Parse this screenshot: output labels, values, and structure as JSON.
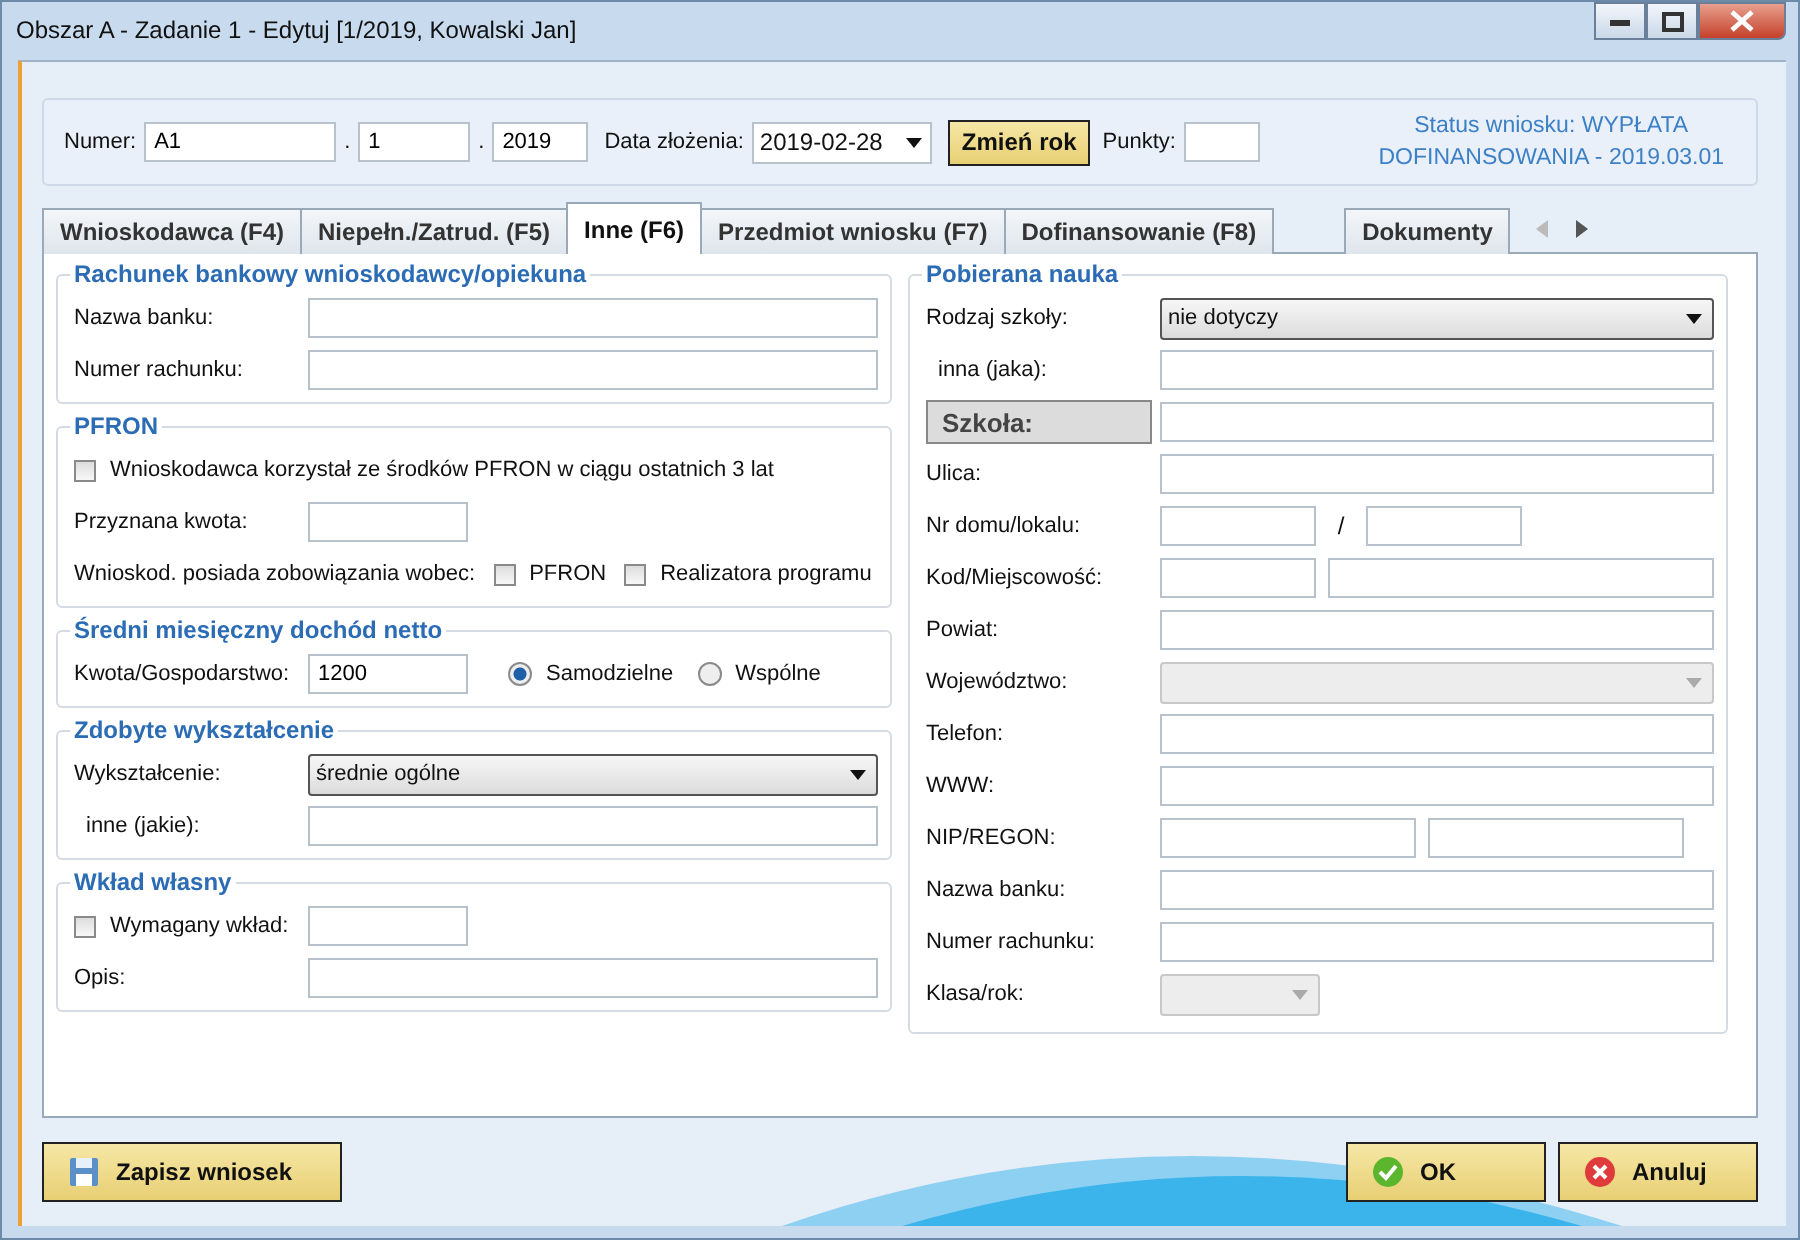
{
  "window": {
    "title": "Obszar A - Zadanie 1 - Edytuj  [1/2019, Kowalski Jan]"
  },
  "header": {
    "numer_label": "Numer:",
    "numer_parts": [
      {
        "value": "A1"
      },
      {
        "separator": ".",
        "value": "1"
      },
      {
        "separator": ".",
        "value": "2019"
      }
    ],
    "date_label": "Data złożenia:",
    "date_value": "2019-02-28",
    "change_year_button": "Zmień rok",
    "points_label": "Punkty:",
    "status_lines": [
      "Status wniosku: WYPŁATA",
      "DOFINANSOWANIA - 2019.03.01"
    ]
  },
  "tabs": [
    {
      "label": "Wnioskodawca (F4)",
      "selected": false
    },
    {
      "label": "Niepełn./Zatrud. (F5)",
      "selected": false
    },
    {
      "label": "Inne (F6)",
      "selected": true
    },
    {
      "label": "Przedmiot wniosku (F7)",
      "selected": false
    },
    {
      "label": "Dofinansowanie (F8)",
      "selected": false
    },
    {
      "label": "Dokumenty",
      "selected": false
    }
  ],
  "left_groups": [
    {
      "title": "Rachunek bankowy wnioskodawcy/opiekuna",
      "rows": [
        {
          "kind": "field",
          "label": "Nazwa banku:"
        },
        {
          "kind": "field",
          "label": "Numer rachunku:"
        }
      ]
    },
    {
      "title": "PFRON",
      "rows": [
        {
          "kind": "checkbox",
          "label": "Wnioskodawca korzystał ze środków PFRON w ciągu ostatnich 3 lat",
          "checked": false
        },
        {
          "kind": "field_short",
          "label": "Przyznana kwota:"
        },
        {
          "kind": "checks",
          "label": "Wnioskod. posiada zobowiązania wobec:",
          "options": [
            {
              "label": "PFRON",
              "checked": false
            },
            {
              "label": "Realizatora programu",
              "checked": false
            }
          ]
        }
      ]
    },
    {
      "title": "Średni miesięczny dochód netto",
      "rows": [
        {
          "kind": "radios",
          "label": "Kwota/Gospodarstwo:",
          "value": "1200",
          "options": [
            {
              "label": "Samodzielne",
              "selected": true
            },
            {
              "label": "Wspólne",
              "selected": false
            }
          ]
        }
      ]
    },
    {
      "title": "Zdobyte wykształcenie",
      "rows": [
        {
          "kind": "select",
          "label": "Wykształcenie:",
          "value": "średnie ogólne",
          "disabled": false
        },
        {
          "kind": "field",
          "label": "inne (jakie):",
          "indent": true
        }
      ]
    },
    {
      "title": "Wkład własny",
      "rows": [
        {
          "kind": "check_field",
          "label": "Wymagany wkład:",
          "checked": false
        },
        {
          "kind": "field",
          "label": "Opis:"
        }
      ]
    }
  ],
  "right_group": {
    "title": "Pobierana nauka",
    "rows": [
      {
        "kind": "select",
        "label": "Rodzaj szkoły:",
        "value": "nie dotyczy",
        "disabled": false
      },
      {
        "kind": "field",
        "label": "inna (jaka):",
        "indent": true
      },
      {
        "kind": "boxed",
        "label": "Szkoła:"
      },
      {
        "kind": "field",
        "label": "Ulica:"
      },
      {
        "kind": "pair_sep",
        "label": "Nr domu/lokalu:",
        "separator": "/"
      },
      {
        "kind": "pair_postal",
        "label": "Kod/Miejscowość:"
      },
      {
        "kind": "field",
        "label": "Powiat:"
      },
      {
        "kind": "select",
        "label": "Województwo:",
        "disabled": true
      },
      {
        "kind": "field",
        "label": "Telefon:"
      },
      {
        "kind": "field",
        "label": "WWW:"
      },
      {
        "kind": "pair_even",
        "label": "NIP/REGON:"
      },
      {
        "kind": "field",
        "label": "Nazwa banku:"
      },
      {
        "kind": "field",
        "label": "Numer rachunku:"
      },
      {
        "kind": "select_short",
        "label": "Klasa/rok:",
        "disabled": true
      }
    ]
  },
  "buttons": {
    "save": "Zapisz wniosek",
    "ok": "OK",
    "cancel": "Anuluj"
  }
}
